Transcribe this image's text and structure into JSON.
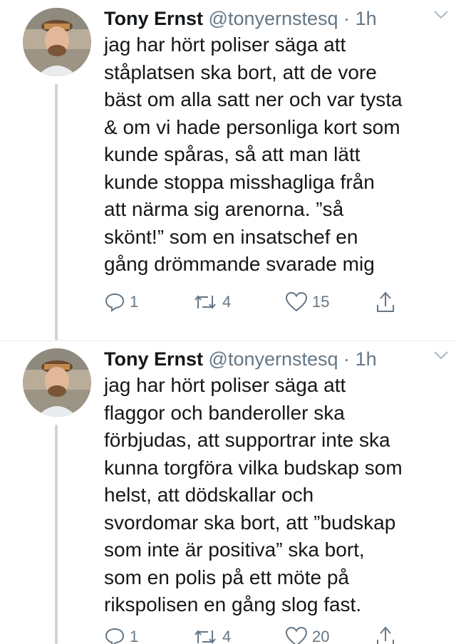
{
  "tweets": [
    {
      "author": {
        "display_name": "Tony Ernst",
        "handle": "@tonyernstesq",
        "separator": "·",
        "time": "1h"
      },
      "text": "jag har hört poliser säga att\nståplatsen ska bort, att de vore\nbäst om alla satt ner och var tysta\n& om vi hade personliga kort som\nkunde spåras, så att man lätt\nkunde stoppa misshagliga från\natt närma sig arenorna. ”så\nskönt!” som en insatschef en\ngång drömmande svarade mig",
      "actions": {
        "reply_count": "1",
        "retweet_count": "4",
        "like_count": "15",
        "share_icon": "share-icon"
      }
    },
    {
      "author": {
        "display_name": "Tony Ernst",
        "handle": "@tonyernstesq",
        "separator": "·",
        "time": "1h"
      },
      "text": "jag har hört poliser säga att\nflaggor och banderoller ska\nförbjudas, att supportrar inte ska\nkunna torgföra vilka budskap som\nhelst, att dödskallar och\nsvordomar ska bort, att ”budskap\nsom inte är positiva” ska bort,\nsom en polis på ett möte på\nrikspolisen en gång slog fast.",
      "actions": {
        "reply_count": "1",
        "retweet_count": "4",
        "like_count": "20",
        "share_icon": "share-icon"
      }
    }
  ],
  "colors": {
    "text": "#14171a",
    "secondary": "#657786",
    "thread_line": "#ccd6dd",
    "divider": "#e6ecf0"
  }
}
